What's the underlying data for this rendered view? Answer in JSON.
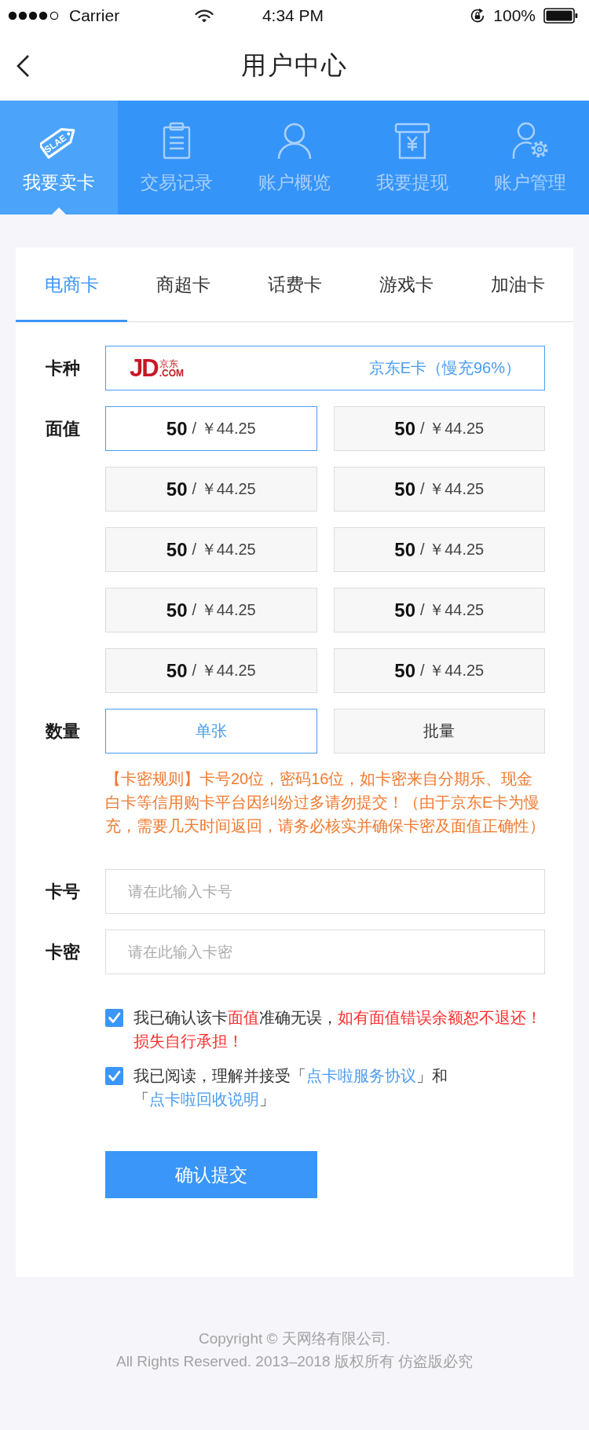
{
  "status_bar": {
    "carrier": "Carrier",
    "time": "4:34 PM",
    "battery": "100%"
  },
  "header": {
    "title": "用户中心"
  },
  "nav": [
    {
      "kind": "sell",
      "label": "我要卖卡",
      "icon_text": "SLAE",
      "selected": true
    },
    {
      "kind": "records",
      "label": "交易记录",
      "selected": false
    },
    {
      "kind": "account",
      "label": "账户概览",
      "selected": false
    },
    {
      "kind": "withdraw",
      "label": "我要提现",
      "selected": false
    },
    {
      "kind": "manage",
      "label": "账户管理",
      "selected": false
    }
  ],
  "card_tabs": [
    {
      "label": "电商卡",
      "selected": true
    },
    {
      "label": "商超卡",
      "selected": false
    },
    {
      "label": "话费卡",
      "selected": false
    },
    {
      "label": "游戏卡",
      "selected": false
    },
    {
      "label": "加油卡",
      "selected": false
    }
  ],
  "card_type": {
    "label": "卡种",
    "logo": {
      "mark": "JD",
      "name": "京东",
      "domain": ".COM"
    },
    "value": "京东E卡（慢充96%）"
  },
  "face_value": {
    "label": "面值",
    "options": [
      {
        "amount": "50",
        "price": "/ ￥44.25",
        "selected": true
      },
      {
        "amount": "50",
        "price": "/ ￥44.25",
        "selected": false
      },
      {
        "amount": "50",
        "price": "/ ￥44.25",
        "selected": false
      },
      {
        "amount": "50",
        "price": "/ ￥44.25",
        "selected": false
      },
      {
        "amount": "50",
        "price": "/ ￥44.25",
        "selected": false
      },
      {
        "amount": "50",
        "price": "/ ￥44.25",
        "selected": false
      },
      {
        "amount": "50",
        "price": "/ ￥44.25",
        "selected": false
      },
      {
        "amount": "50",
        "price": "/ ￥44.25",
        "selected": false
      },
      {
        "amount": "50",
        "price": "/ ￥44.25",
        "selected": false
      },
      {
        "amount": "50",
        "price": "/ ￥44.25",
        "selected": false
      }
    ]
  },
  "quantity": {
    "label": "数量",
    "options": [
      {
        "label": "单张",
        "selected": true
      },
      {
        "label": "批量",
        "selected": false
      }
    ]
  },
  "rules": "【卡密规则】卡号20位，密码16位，如卡密来自分期乐、现金白卡等信用购卡平台因纠纷过多请勿提交！（由于京东E卡为慢充，需要几天时间返回，请务必核实并确保卡密及面值正确性）",
  "card_number": {
    "label": "卡号",
    "placeholder": "请在此输入卡号"
  },
  "card_password": {
    "label": "卡密",
    "placeholder": "请在此输入卡密"
  },
  "agreements": [
    {
      "checked": true,
      "parts": [
        {
          "kind": "plain",
          "text": "我已确认该卡"
        },
        {
          "kind": "warning",
          "text": "面值"
        },
        {
          "kind": "plain",
          "text": "准确无误，"
        },
        {
          "kind": "warning",
          "text": "如有面值错误余额恕不退还！损失自行承担！"
        }
      ]
    },
    {
      "checked": true,
      "parts": [
        {
          "kind": "plain",
          "text": "我已阅读，理解并接受「"
        },
        {
          "kind": "link",
          "text": "点卡啦服务协议"
        },
        {
          "kind": "plain",
          "text": "」和「"
        },
        {
          "kind": "link",
          "text": "点卡啦回收说明"
        },
        {
          "kind": "plain",
          "text": "」"
        }
      ]
    }
  ],
  "submit": {
    "label": "确认提交"
  },
  "footer": [
    "Copyright © 天网络有限公司.",
    "All Rights Reserved. 2013–2018 版权所有 仿盗版必究"
  ]
}
